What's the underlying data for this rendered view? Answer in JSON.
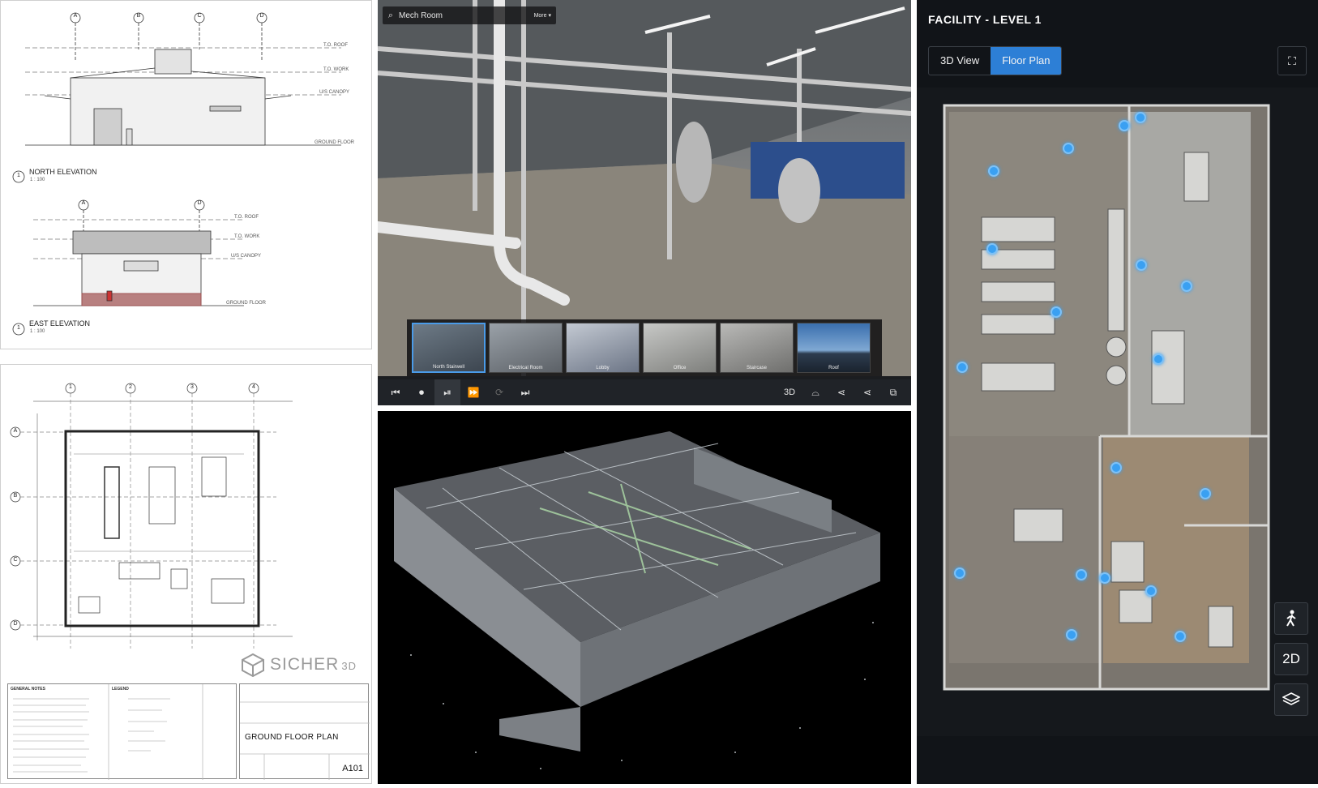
{
  "elevations": {
    "north_label": "NORTH ELEVATION",
    "north_scale": "1 : 100",
    "east_label": "EAST ELEVATION",
    "east_scale": "1 : 100",
    "north_grid": [
      "A",
      "B",
      "C",
      "D"
    ],
    "east_grid": [
      "A",
      "D"
    ],
    "north_levels": [
      "T.O. ROOF",
      "T.O. WORK",
      "U/S CANOPY",
      "GROUND FLOOR"
    ],
    "east_levels": [
      "T.O. ROOF",
      "T.O. WORK",
      "U/S CANOPY",
      "GROUND FLOOR"
    ],
    "view_numbers": [
      "1",
      "1"
    ]
  },
  "plan_drawing": {
    "grid_cols": [
      "1",
      "2",
      "3",
      "4"
    ],
    "grid_rows": [
      "A",
      "B",
      "C",
      "D"
    ],
    "notes_title": "GENERAL NOTES",
    "legend_title": "LEGEND",
    "logo": "SICHER",
    "logo_suffix": "3D",
    "sheet_name": "GROUND FLOOR PLAN",
    "sheet_number": "A101"
  },
  "viewer": {
    "search_value": "Mech Room",
    "more_label": "More ▾",
    "thumbnails": [
      {
        "label": "North Stairwell",
        "selected": true
      },
      {
        "label": "Electrical Room",
        "selected": false
      },
      {
        "label": "Lobby",
        "selected": false
      },
      {
        "label": "Office",
        "selected": false
      },
      {
        "label": "Staircase",
        "selected": false
      },
      {
        "label": "Roof",
        "selected": false
      }
    ],
    "controls": {
      "three_d_label": "3D",
      "icons": [
        "skip-back-icon",
        "record-icon",
        "play-pause-icon",
        "fast-forward-icon",
        "loop-icon",
        "skip-end-icon"
      ]
    }
  },
  "app": {
    "title": "FACILITY - LEVEL 1",
    "tabs": [
      {
        "label": "3D View",
        "active": false
      },
      {
        "label": "Floor Plan",
        "active": true
      }
    ],
    "side_buttons": {
      "walk": "walk-icon",
      "mode_label": "2D",
      "layers": "layers-icon"
    },
    "accent": "#2d7fd6",
    "marker_color": "#3aa0f2",
    "marker_count": 24
  }
}
